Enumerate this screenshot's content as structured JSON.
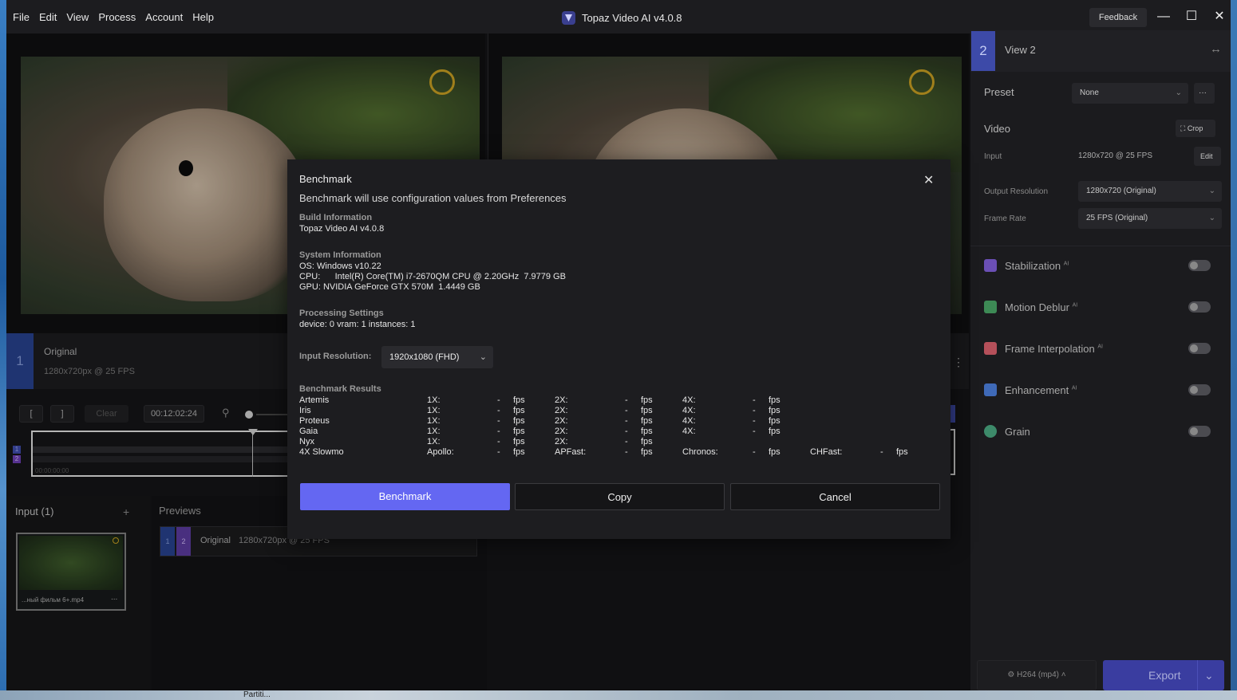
{
  "menu": [
    "File",
    "Edit",
    "View",
    "Process",
    "Account",
    "Help"
  ],
  "app_title": "Topaz Video AI  v4.0.8",
  "feedback_label": "Feedback",
  "window_controls": {
    "minimize": "—",
    "maximize": "☐",
    "close": "✕"
  },
  "left_view": {
    "number": "1",
    "title": "Original",
    "meta": "1280x720px @ 25 FPS"
  },
  "timeline": {
    "in_btn": "[",
    "out_btn": "]",
    "clear_btn": "Clear",
    "timecode": "00:12:02:24",
    "start_time": "00:00:00:00",
    "track_labels": [
      "1",
      "2"
    ]
  },
  "input_panel": {
    "title": "Input (1)",
    "add": "+",
    "file_name": "...ный фильм 6+.mp4",
    "file_menu": "..."
  },
  "previews_panel": {
    "title": "Previews",
    "row": {
      "n1": "1",
      "n2": "2",
      "label": "Original",
      "meta": "1280x720px @ 25 FPS"
    }
  },
  "desktop_label": "Partiti...",
  "sidebar": {
    "view_number": "2",
    "view_title": "View 2",
    "swap_icon": "↔",
    "preset_label": "Preset",
    "preset_value": "None",
    "preset_more": "···",
    "video_label": "Video",
    "crop_label": "Crop",
    "input_label": "Input",
    "input_value": "1280x720 @ 25 FPS",
    "edit_label": "Edit",
    "output_res_label": "Output Resolution",
    "output_res_value": "1280x720 (Original)",
    "frame_rate_label": "Frame Rate",
    "frame_rate_value": "25 FPS (Original)",
    "filters": [
      {
        "name": "Stabilization",
        "tag": "AI",
        "color": "#6b4fb5"
      },
      {
        "name": "Motion Deblur",
        "tag": "AI",
        "color": "#3d8a55"
      },
      {
        "name": "Frame Interpolation",
        "tag": "AI",
        "color": "#b5505a"
      },
      {
        "name": "Enhancement",
        "tag": "AI",
        "color": "#3f6ab8"
      },
      {
        "name": "Grain",
        "tag": "",
        "color": "#3d8a6a"
      }
    ],
    "encoder_label": "H264 (mp4)",
    "export_label": "Export"
  },
  "modal": {
    "title": "Benchmark",
    "subtitle": "Benchmark will use configuration values from Preferences",
    "build_heading": "Build Information",
    "build_value": "Topaz Video AI v4.0.8",
    "system_heading": "System Information",
    "os_line": "OS: Windows v10.22",
    "cpu_line": "CPU:      Intel(R) Core(TM) i7-2670QM CPU @ 2.20GHz  7.9779 GB",
    "gpu_line": "GPU: NVIDIA GeForce GTX 570M  1.4449 GB",
    "processing_heading": "Processing Settings",
    "processing_value": "device: 0 vram: 1 instances: 1",
    "input_res_label": "Input Resolution:",
    "input_res_value": "1920x1080 (FHD)",
    "results_heading": "Benchmark Results",
    "results": [
      {
        "model": "Artemis",
        "cols": [
          [
            "1X:",
            "-",
            "fps"
          ],
          [
            "2X:",
            "-",
            "fps"
          ],
          [
            "4X:",
            "-",
            "fps"
          ]
        ]
      },
      {
        "model": "Iris",
        "cols": [
          [
            "1X:",
            "-",
            "fps"
          ],
          [
            "2X:",
            "-",
            "fps"
          ],
          [
            "4X:",
            "-",
            "fps"
          ]
        ]
      },
      {
        "model": "Proteus",
        "cols": [
          [
            "1X:",
            "-",
            "fps"
          ],
          [
            "2X:",
            "-",
            "fps"
          ],
          [
            "4X:",
            "-",
            "fps"
          ]
        ]
      },
      {
        "model": "Gaia",
        "cols": [
          [
            "1X:",
            "-",
            "fps"
          ],
          [
            "2X:",
            "-",
            "fps"
          ],
          [
            "4X:",
            "-",
            "fps"
          ]
        ]
      },
      {
        "model": "Nyx",
        "cols": [
          [
            "1X:",
            "-",
            "fps"
          ],
          [
            "2X:",
            "-",
            "fps"
          ]
        ]
      },
      {
        "model": "4X Slowmo",
        "cols": [
          [
            "Apollo:",
            "-",
            "fps"
          ],
          [
            "APFast:",
            "-",
            "fps"
          ],
          [
            "Chronos:",
            "-",
            "fps"
          ],
          [
            "CHFast:",
            "-",
            "fps"
          ]
        ]
      }
    ],
    "benchmark_btn": "Benchmark",
    "copy_btn": "Copy",
    "cancel_btn": "Cancel"
  }
}
